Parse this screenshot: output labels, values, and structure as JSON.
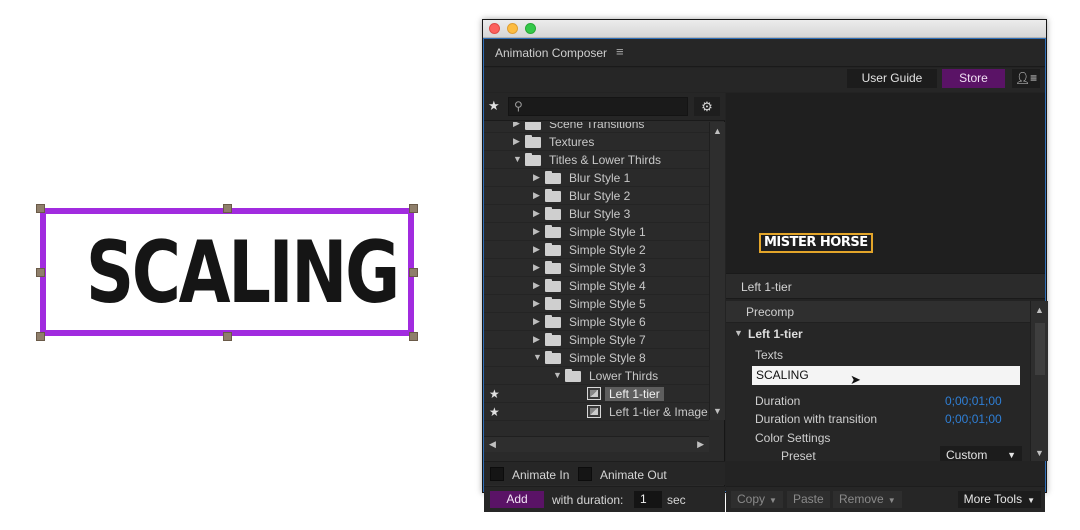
{
  "canvas": {
    "text": "SCALING"
  },
  "window": {
    "title": "Animation Composer"
  },
  "topbar": {
    "user_guide": "User Guide",
    "store": "Store"
  },
  "tree": {
    "items": [
      {
        "label": "Scene Transitions",
        "expanded": false
      },
      {
        "label": "Textures",
        "expanded": false
      },
      {
        "label": "Titles & Lower Thirds",
        "expanded": true
      },
      {
        "label": "Blur Style 1",
        "expanded": false
      },
      {
        "label": "Blur Style 2",
        "expanded": false
      },
      {
        "label": "Blur Style 3",
        "expanded": false
      },
      {
        "label": "Simple Style 1",
        "expanded": false
      },
      {
        "label": "Simple Style 2",
        "expanded": false
      },
      {
        "label": "Simple Style 3",
        "expanded": false
      },
      {
        "label": "Simple Style 4",
        "expanded": false
      },
      {
        "label": "Simple Style 5",
        "expanded": false
      },
      {
        "label": "Simple Style 6",
        "expanded": false
      },
      {
        "label": "Simple Style 7",
        "expanded": false
      },
      {
        "label": "Simple Style 8",
        "expanded": true
      },
      {
        "label": "Lower Thirds",
        "expanded": true
      },
      {
        "label": "Left 1-tier",
        "selected": true
      },
      {
        "label": "Left 1-tier & Image"
      }
    ]
  },
  "animate": {
    "in_label": "Animate In",
    "out_label": "Animate Out"
  },
  "add_row": {
    "add_label": "Add",
    "duration_label": "with duration:",
    "duration_value": "1",
    "unit": "sec"
  },
  "preview": {
    "logo_text": "MISTER HORSE"
  },
  "preset_name": "Left 1-tier",
  "properties": {
    "precomp": "Precomp",
    "group": "Left 1-tier",
    "texts_label": "Texts",
    "text_value": "SCALING",
    "duration_label": "Duration",
    "duration_value": "0;00;01;00",
    "duration_transition_label": "Duration with transition",
    "duration_transition_value": "0;00;01;00",
    "color_settings_label": "Color Settings",
    "preset_label": "Preset",
    "preset_value": "Custom"
  },
  "tools": {
    "copy": "Copy",
    "paste": "Paste",
    "remove": "Remove",
    "more_tools": "More Tools"
  },
  "colors": {
    "accent_purple": "#5a1366",
    "selection_purple": "#a12bdf",
    "value_blue": "#2f7fd6",
    "logo_gold": "#e3a52a"
  }
}
